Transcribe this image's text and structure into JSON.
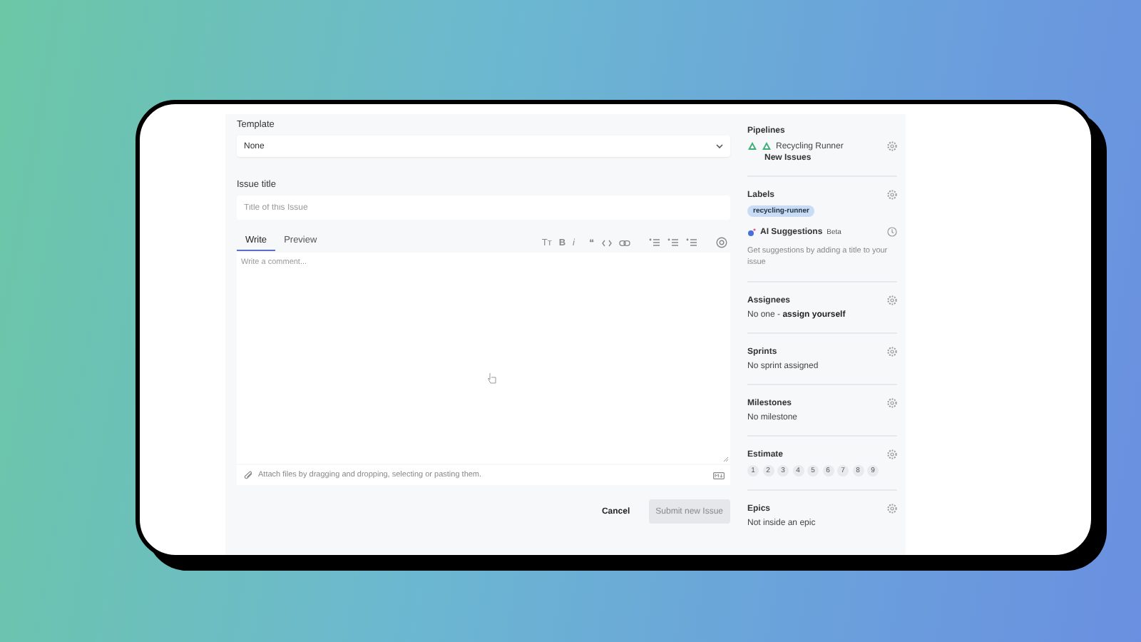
{
  "form": {
    "template_label": "Template",
    "template_value": "None",
    "title_label": "Issue title",
    "title_placeholder": "Title of this Issue",
    "tabs": [
      {
        "label": "Write",
        "selected": true
      },
      {
        "label": "Preview",
        "selected": false
      }
    ],
    "toolbar_glyphs": [
      "Tт",
      "B",
      "i",
      "❝"
    ],
    "comment_placeholder": "Write a comment...",
    "attach_hint": "Attach files by dragging and dropping, selecting or pasting them.",
    "buttons": [
      {
        "label": "Cancel",
        "kind": "plain",
        "disabled": false
      },
      {
        "label": "Submit new Issue",
        "kind": "primary",
        "disabled": true
      }
    ]
  },
  "sidebar": {
    "pipelines": {
      "title": "Pipelines",
      "workspace": "Recycling Runner",
      "pipeline": "New Issues"
    },
    "labels": {
      "title": "Labels",
      "tags": [
        {
          "text": "recycling-runner",
          "color": "#c9dcf5"
        }
      ],
      "ai_title": "AI Suggestions",
      "ai_badge": "Beta",
      "ai_hint": "Get suggestions by adding a title to your issue"
    },
    "assignees": {
      "title": "Assignees",
      "text": "No one -",
      "link": "assign yourself"
    },
    "sprints": {
      "title": "Sprints",
      "text": "No sprint assigned"
    },
    "milestones": {
      "title": "Milestones",
      "text": "No milestone"
    },
    "estimate": {
      "title": "Estimate",
      "options": [
        "1",
        "2",
        "3",
        "4",
        "5",
        "6",
        "7",
        "8",
        "9"
      ]
    },
    "epics": {
      "title": "Epics",
      "text": "Not inside an epic"
    }
  }
}
